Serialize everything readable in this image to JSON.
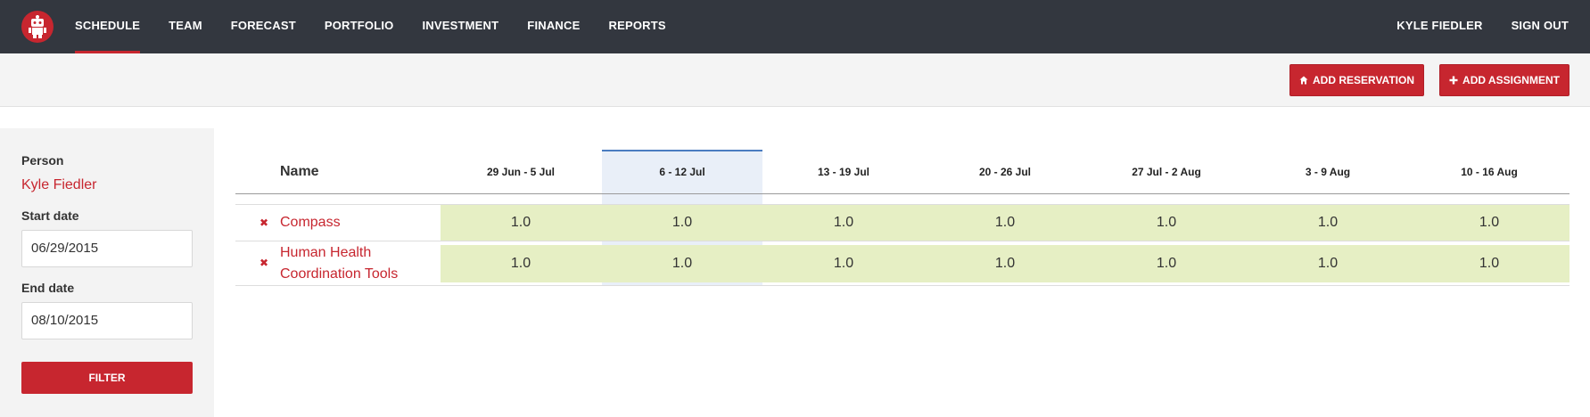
{
  "nav": {
    "items": [
      "SCHEDULE",
      "TEAM",
      "FORECAST",
      "PORTFOLIO",
      "INVESTMENT",
      "FINANCE",
      "REPORTS"
    ],
    "active_index": 0,
    "user": "KYLE FIEDLER",
    "signout": "SIGN OUT"
  },
  "actions": {
    "add_reservation": "ADD RESERVATION",
    "add_assignment": "ADD ASSIGNMENT"
  },
  "filter": {
    "person_label": "Person",
    "person_value": "Kyle Fiedler",
    "start_label": "Start date",
    "start_value": "06/29/2015",
    "end_label": "End date",
    "end_value": "08/10/2015",
    "button": "FILTER"
  },
  "table": {
    "name_header": "Name",
    "weeks": [
      "29 Jun - 5 Jul",
      "6 - 12 Jul",
      "13 - 19 Jul",
      "20 - 26 Jul",
      "27 Jul - 2 Aug",
      "3 - 9 Aug",
      "10 - 16 Aug"
    ],
    "highlighted_week_index": 1,
    "rows": [
      {
        "name": "Compass",
        "values": [
          "1.0",
          "1.0",
          "1.0",
          "1.0",
          "1.0",
          "1.0",
          "1.0"
        ]
      },
      {
        "name": "Human Health Coordination Tools",
        "values": [
          "1.0",
          "1.0",
          "1.0",
          "1.0",
          "1.0",
          "1.0",
          "1.0"
        ]
      }
    ]
  },
  "colors": {
    "brand_red": "#c7262f",
    "nav_bg": "#33373f",
    "cell_green": "#e6efc4",
    "highlight_blue": "#e9eff8"
  }
}
